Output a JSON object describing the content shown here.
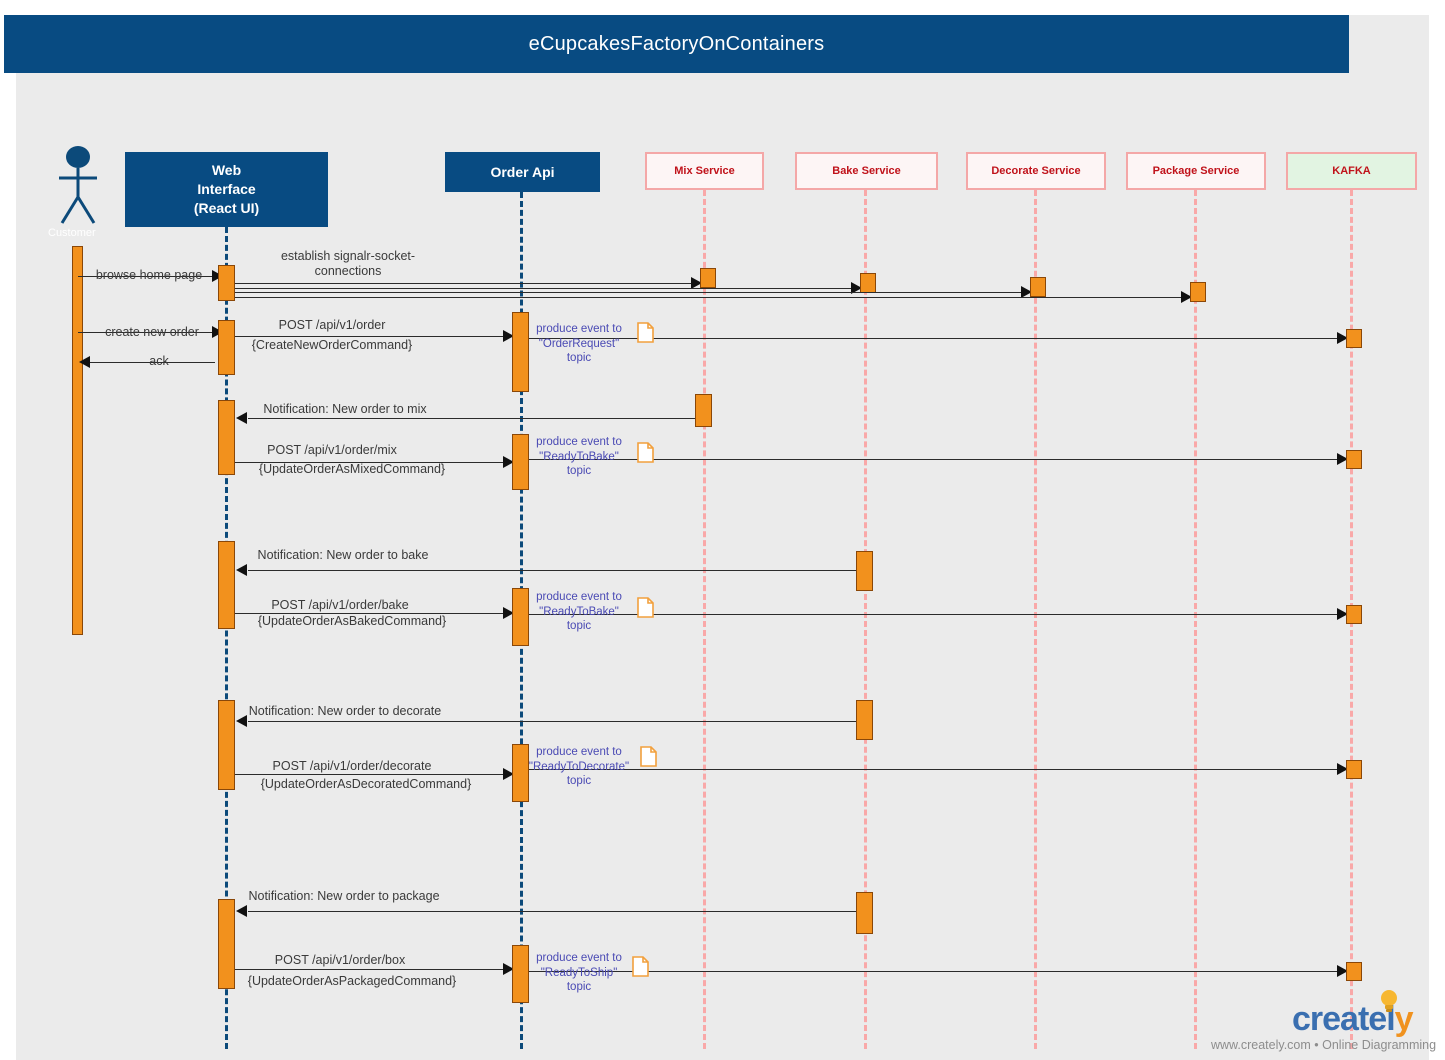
{
  "diagram": {
    "title": "eCupcakesFactoryOnContainers",
    "type": "uml-sequence-diagram",
    "colors": {
      "title_bar": "#084b82",
      "background": "#ebebeb",
      "participant_dark": "#084b82",
      "service_box_fill": "#fdf5f5",
      "service_box_border": "#f4a7a7",
      "kafka_box_fill": "#e2f4e2",
      "activation_bar": "#f2911d",
      "activation_border": "#8a4708",
      "note_text": "#4a4ab4",
      "service_label": "#c0121a",
      "message_text": "#3a3a3a"
    }
  },
  "participants": [
    {
      "id": "customer",
      "label": "Customer",
      "kind": "actor"
    },
    {
      "id": "web",
      "label": "Web\nInterface\n(React UI)",
      "line1": "Web",
      "line2": "Interface",
      "line3": "(React UI)",
      "kind": "box-dark"
    },
    {
      "id": "orderapi",
      "label": "Order Api",
      "kind": "box-dark"
    },
    {
      "id": "mix",
      "label": "Mix Service",
      "kind": "box-service"
    },
    {
      "id": "bake",
      "label": "Bake Service",
      "kind": "box-service"
    },
    {
      "id": "decorate",
      "label": "Decorate Service",
      "kind": "box-service"
    },
    {
      "id": "package",
      "label": "Package  Service",
      "kind": "box-service"
    },
    {
      "id": "kafka",
      "label": "KAFKA",
      "kind": "box-kafka"
    }
  ],
  "messages": [
    {
      "id": "m1",
      "from": "customer",
      "to": "web",
      "label": "browse home page"
    },
    {
      "id": "m2",
      "from": "web",
      "to": "mix",
      "label": "establish signalr-socket-\nconnections",
      "line1": "establish signalr-socket-",
      "line2": "connections"
    },
    {
      "id": "m3",
      "from": "web",
      "to": "bake",
      "label": ""
    },
    {
      "id": "m4",
      "from": "web",
      "to": "decorate",
      "label": ""
    },
    {
      "id": "m5",
      "from": "web",
      "to": "package",
      "label": ""
    },
    {
      "id": "m6",
      "from": "customer",
      "to": "web",
      "label": "create new order"
    },
    {
      "id": "m7",
      "from": "web",
      "to": "orderapi",
      "line1": "POST /api/v1/order",
      "line2": "{CreateNewOrderCommand}"
    },
    {
      "id": "m8",
      "from": "orderapi",
      "to": "kafka",
      "note_line1": "produce event to",
      "note_line2": "\"OrderRequest\"",
      "note_line3": "topic"
    },
    {
      "id": "m9",
      "from": "web",
      "to": "customer",
      "label": "ack"
    },
    {
      "id": "m10",
      "from": "mix",
      "to": "web",
      "label": "Notification: New order to mix"
    },
    {
      "id": "m11",
      "from": "web",
      "to": "orderapi",
      "line1": "POST /api/v1/order/mix",
      "line2": "{UpdateOrderAsMixedCommand}"
    },
    {
      "id": "m12",
      "from": "orderapi",
      "to": "kafka",
      "note_line1": "produce event to",
      "note_line2": "\"ReadyToBake\"",
      "note_line3": "topic"
    },
    {
      "id": "m13",
      "from": "bake",
      "to": "web",
      "label": "Notification: New order to bake"
    },
    {
      "id": "m14",
      "from": "web",
      "to": "orderapi",
      "line1": "POST /api/v1/order/bake",
      "line2": "{UpdateOrderAsBakedCommand}"
    },
    {
      "id": "m15",
      "from": "orderapi",
      "to": "kafka",
      "note_line1": "produce event to",
      "note_line2": "\"ReadyToBake\"",
      "note_line3": "topic"
    },
    {
      "id": "m16",
      "from": "bake",
      "to": "web",
      "label": "Notification: New order to decorate"
    },
    {
      "id": "m17",
      "from": "web",
      "to": "orderapi",
      "line1": "POST /api/v1/order/decorate",
      "line2": "{UpdateOrderAsDecoratedCommand}"
    },
    {
      "id": "m18",
      "from": "orderapi",
      "to": "kafka",
      "note_line1": "produce event to",
      "note_line2": "\"ReadyToDecorate\"",
      "note_line3": "topic"
    },
    {
      "id": "m19",
      "from": "bake",
      "to": "web",
      "label": "Notification: New order to package"
    },
    {
      "id": "m20",
      "from": "web",
      "to": "orderapi",
      "line1": "POST /api/v1/order/box",
      "line2": "{UpdateOrderAsPackagedCommand}"
    },
    {
      "id": "m21",
      "from": "orderapi",
      "to": "kafka",
      "note_line1": "produce event to",
      "note_line2": "\"ReadyToShip\"",
      "note_line3": "topic"
    }
  ],
  "watermark": {
    "brand_a": "create",
    "brand_b": "l",
    "brand_c": "y",
    "tagline": "www.creately.com • Online Diagramming"
  }
}
